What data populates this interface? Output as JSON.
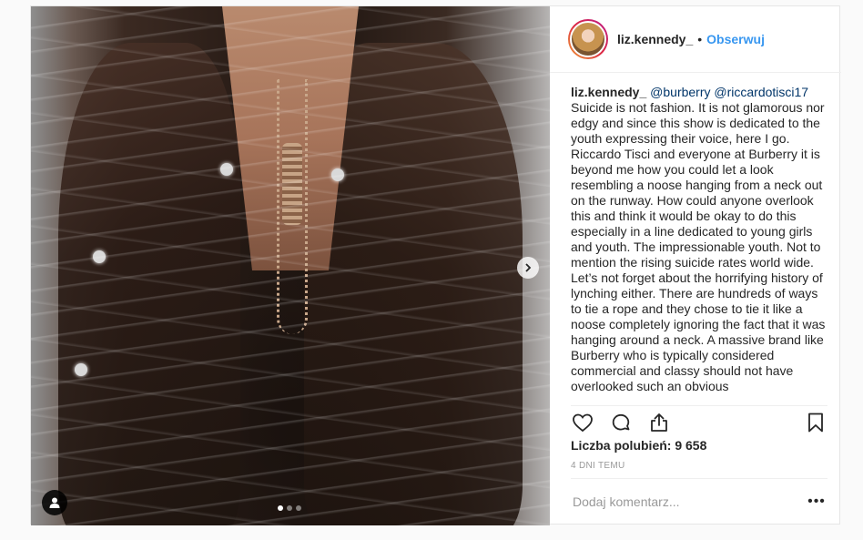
{
  "post": {
    "username": "liz.kennedy_",
    "separator": "•",
    "follow_label": "Obserwuj",
    "caption": {
      "user": "liz.kennedy_",
      "mention1": "@burberry",
      "mention2": "@riccardotisci17",
      "text": "Suicide is not fashion. It is not glamorous nor edgy and since this show is dedicated to the youth expressing their voice, here I go. Riccardo Tisci and everyone at Burberry it is beyond me how you could let a look resembling a noose hanging from a neck out on the runway. How could anyone overlook this and think it would be okay to do this especially in a line dedicated to young girls and youth. The impressionable youth. Not to mention the rising suicide rates world wide. Let’s not forget about the horrifying history of lynching either. There are hundreds of ways to tie a rope and they chose to tie it like a noose completely ignoring the fact that it was hanging around a neck. A massive brand like Burberry who is typically considered commercial and classy should not have overlooked such an obvious"
    },
    "likes_label": "Liczba polubień: 9 658",
    "time_label": "4 DNI TEMU",
    "comment_placeholder": "Dodaj komentarz...",
    "more_label": "•••",
    "carousel": {
      "count": 3,
      "active": 0
    }
  },
  "icons": {
    "like": "heart-icon",
    "comment": "comment-icon",
    "share": "share-icon",
    "save": "bookmark-icon",
    "next": "chevron-right-icon",
    "tag": "user-tag-icon"
  },
  "colors": {
    "link": "#3897f0",
    "text": "#262626",
    "muted": "#999999",
    "border": "#efefef"
  }
}
